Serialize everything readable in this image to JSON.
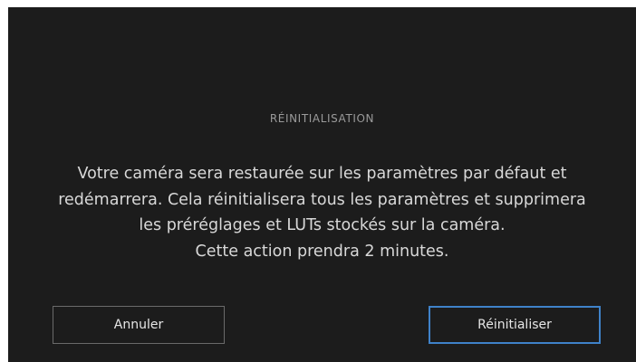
{
  "dialog": {
    "title": "RÉINITIALISATION",
    "message_lines": [
      "Votre caméra sera restaurée sur les paramètres par défaut et",
      "redémarrera. Cela réinitialisera tous les paramètres et supprimera",
      "les préréglages et LUTs stockés sur la caméra.",
      "Cette action prendra 2 minutes."
    ],
    "cancel_label": "Annuler",
    "confirm_label": "Réinitialiser"
  },
  "colors": {
    "background": "#1c1c1c",
    "accent": "#3f82c9"
  }
}
